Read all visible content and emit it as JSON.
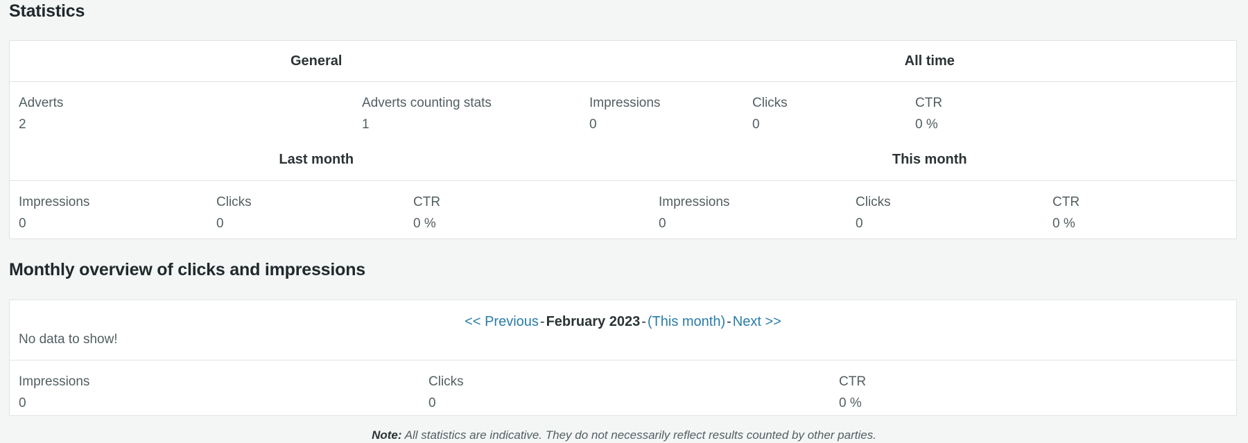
{
  "sections": {
    "statistics_heading": "Statistics",
    "monthly_heading": "Monthly overview of clicks and impressions"
  },
  "colors": {
    "link": "#2a7ca8",
    "text": "#525e61",
    "heading": "#20292b",
    "border": "#dfe3e4",
    "background": "#f4f6f6",
    "card_background": "#ffffff"
  },
  "statistics_table": {
    "group_headers_top": {
      "left": "General",
      "right": "All time"
    },
    "row_general": [
      {
        "label": "Adverts",
        "value": "2"
      },
      {
        "label": "Adverts counting stats",
        "value": "1"
      },
      {
        "label": "Impressions",
        "value": "0"
      },
      {
        "label": "Clicks",
        "value": "0"
      },
      {
        "label": "CTR",
        "value": "0 %"
      }
    ],
    "group_headers_bottom": {
      "left": "Last month",
      "right": "This month"
    },
    "row_months": [
      {
        "label": "Impressions",
        "value": "0"
      },
      {
        "label": "Clicks",
        "value": "0"
      },
      {
        "label": "CTR",
        "value": "0 %"
      },
      {
        "label": "Impressions",
        "value": "0"
      },
      {
        "label": "Clicks",
        "value": "0"
      },
      {
        "label": "CTR",
        "value": "0 %"
      }
    ]
  },
  "monthly_card": {
    "pager": {
      "previous": "<< Previous",
      "separator": "-",
      "current_month": "February 2023",
      "this_month": "(This month)",
      "next": "Next >>"
    },
    "empty_message": "No data to show!",
    "metrics": [
      {
        "label": "Impressions",
        "value": "0"
      },
      {
        "label": "Clicks",
        "value": "0"
      },
      {
        "label": "CTR",
        "value": "0 %"
      }
    ]
  },
  "footer": {
    "note_prefix": "Note:",
    "note_text": "All statistics are indicative. They do not necessarily reflect results counted by other parties."
  }
}
